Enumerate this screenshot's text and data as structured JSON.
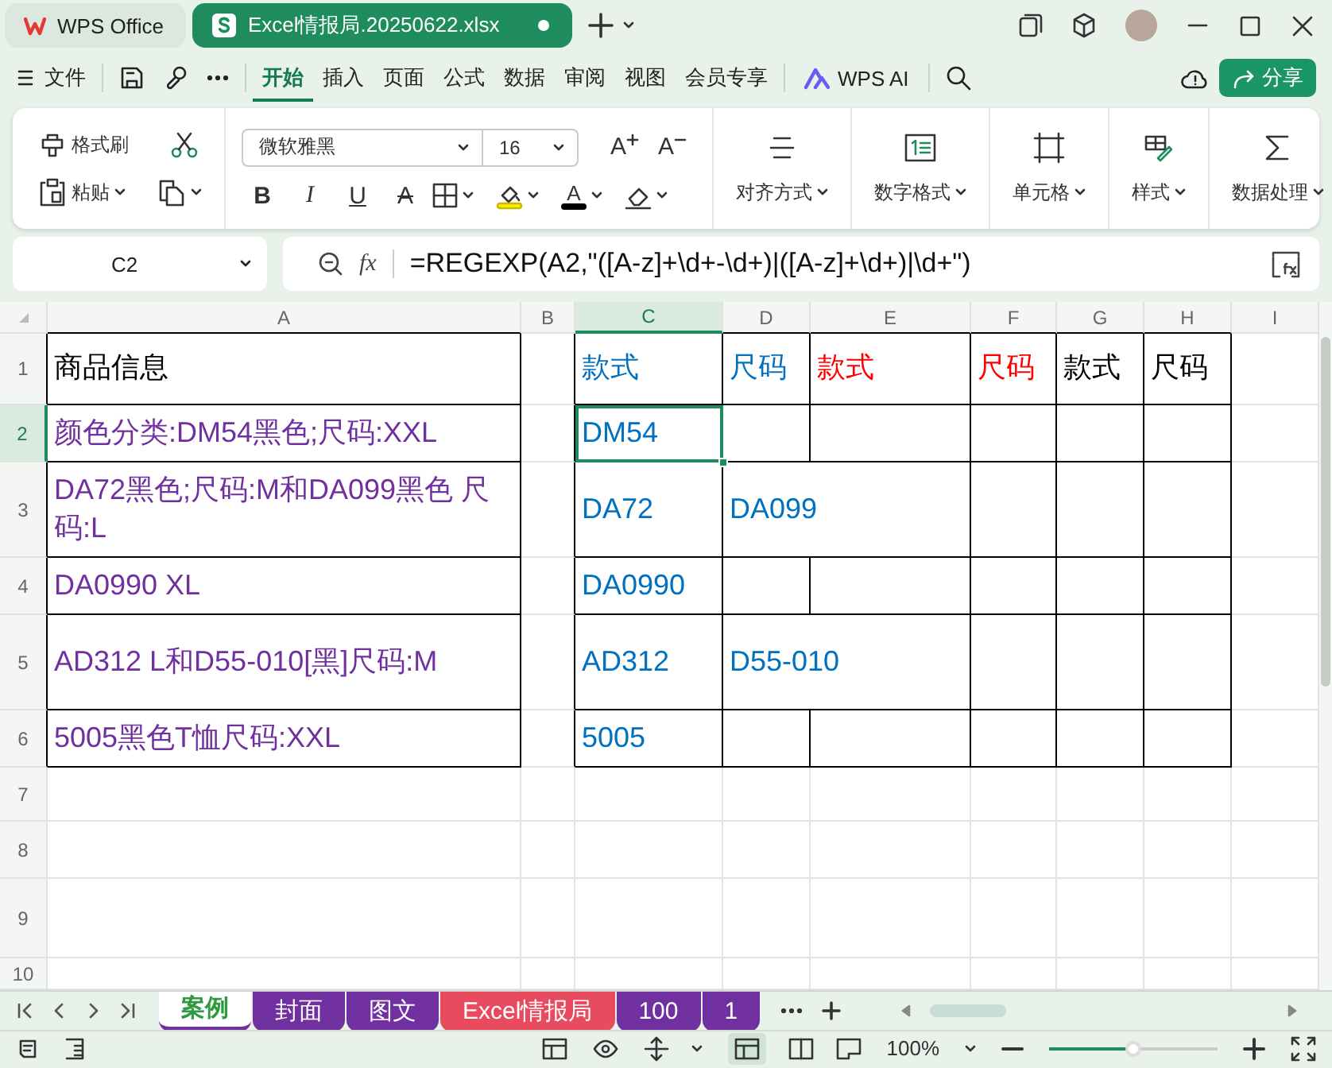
{
  "title_bar": {
    "tabs": [
      {
        "label": "WPS Office",
        "selected": false
      },
      {
        "label": "Excel情报局.20250622.xlsx",
        "selected": true
      }
    ]
  },
  "menu_bar": {
    "file": "文件",
    "tabs": [
      {
        "label": "开始",
        "selected": true
      },
      {
        "label": "插入",
        "selected": false
      },
      {
        "label": "页面",
        "selected": false
      },
      {
        "label": "公式",
        "selected": false
      },
      {
        "label": "数据",
        "selected": false
      },
      {
        "label": "审阅",
        "selected": false
      },
      {
        "label": "视图",
        "selected": false
      },
      {
        "label": "会员专享",
        "selected": false
      }
    ],
    "ai": "WPS AI",
    "share": "分享"
  },
  "ribbon": {
    "format_painter": "格式刷",
    "paste": "粘贴",
    "font_name": "微软雅黑",
    "font_size": "16",
    "grow_font": "A",
    "shrink_font": "A",
    "styles": [
      {
        "kind": "bold",
        "label": "B"
      },
      {
        "kind": "italic",
        "label": "I"
      },
      {
        "kind": "underline",
        "label": "U"
      },
      {
        "kind": "strike",
        "label": "A"
      }
    ],
    "font_color": "A",
    "groups": [
      {
        "kind": "align",
        "label": "对齐方式"
      },
      {
        "kind": "number",
        "label": "数字格式"
      },
      {
        "kind": "cells",
        "label": "单元格"
      },
      {
        "kind": "style",
        "label": "样式"
      },
      {
        "kind": "sum",
        "label": "数据处理"
      }
    ]
  },
  "formula_bar": {
    "cell_ref": "C2",
    "fx": "fx",
    "formula": "=REGEXP(A2,\"([A-z]+\\d+-\\d+)|([A-z]+\\d+)|\\d+\")"
  },
  "sheet": {
    "columns": [
      {
        "label": "A",
        "selected": false
      },
      {
        "label": "B",
        "selected": false
      },
      {
        "label": "C",
        "selected": true
      },
      {
        "label": "D",
        "selected": false
      },
      {
        "label": "E",
        "selected": false
      },
      {
        "label": "F",
        "selected": false
      },
      {
        "label": "G",
        "selected": false
      },
      {
        "label": "H",
        "selected": false
      },
      {
        "label": "I",
        "selected": false
      }
    ],
    "rows": [
      {
        "number": "1",
        "selected": false,
        "cells": {
          "A": {
            "text": "商品信息",
            "color": "#000000",
            "selected": false
          },
          "C": {
            "text": "款式",
            "color": "#0070c0",
            "selected": false
          },
          "D": {
            "text": "尺码",
            "color": "#0070c0",
            "selected": false
          },
          "E": {
            "text": "款式",
            "color": "#ff0000",
            "selected": false
          },
          "F": {
            "text": "尺码",
            "color": "#ff0000",
            "selected": false
          },
          "G": {
            "text": "款式",
            "color": "#000000",
            "selected": false
          },
          "H": {
            "text": "尺码",
            "color": "#000000",
            "selected": false
          }
        }
      },
      {
        "number": "2",
        "selected": true,
        "cells": {
          "A": {
            "text": "颜色分类:DM54黑色;尺码:XXL",
            "color": "#7030a0",
            "selected": false
          },
          "C": {
            "text": "DM54",
            "color": "#0070c0",
            "selected": true
          }
        }
      },
      {
        "number": "3",
        "selected": false,
        "cells": {
          "A": {
            "text": "DA72黑色;尺码:M和DA099黑色 尺码:L",
            "color": "#7030a0",
            "selected": false
          },
          "C": {
            "text": "DA72",
            "color": "#0070c0",
            "selected": false
          },
          "D": {
            "text": "DA099",
            "color": "#0070c0",
            "selected": false
          }
        }
      },
      {
        "number": "4",
        "selected": false,
        "cells": {
          "A": {
            "text": "DA0990 XL",
            "color": "#7030a0",
            "selected": false
          },
          "C": {
            "text": "DA0990",
            "color": "#0070c0",
            "selected": false
          }
        }
      },
      {
        "number": "5",
        "selected": false,
        "cells": {
          "A": {
            "text": "AD312 L和D55-010[黑]尺码:M",
            "color": "#7030a0",
            "selected": false
          },
          "C": {
            "text": "AD312",
            "color": "#0070c0",
            "selected": false
          },
          "D": {
            "text": "D55-010",
            "color": "#0070c0",
            "selected": false
          }
        }
      },
      {
        "number": "6",
        "selected": false,
        "cells": {
          "A": {
            "text": "5005黑色T恤尺码:XXL",
            "color": "#7030a0",
            "selected": false
          },
          "C": {
            "text": "5005",
            "color": "#0070c0",
            "selected": false
          }
        }
      },
      {
        "number": "7",
        "selected": false
      },
      {
        "number": "8",
        "selected": false
      },
      {
        "number": "9",
        "selected": false
      },
      {
        "number": "10",
        "selected": false
      }
    ]
  },
  "sheet_tabs": [
    {
      "label": "案例",
      "selected": true,
      "color": "#7030a0"
    },
    {
      "label": "封面",
      "selected": false,
      "color": "#7030a0"
    },
    {
      "label": "图文",
      "selected": false,
      "color": "#7030a0"
    },
    {
      "label": "Excel情报局",
      "selected": false,
      "color": "#e84a5f"
    },
    {
      "label": "100",
      "selected": false,
      "color": "#7030a0"
    },
    {
      "label": "1",
      "selected": false,
      "color": "#7030a0"
    }
  ],
  "status_bar": {
    "zoom": "100%",
    "zoom_slider": {
      "level": 0.5
    }
  }
}
